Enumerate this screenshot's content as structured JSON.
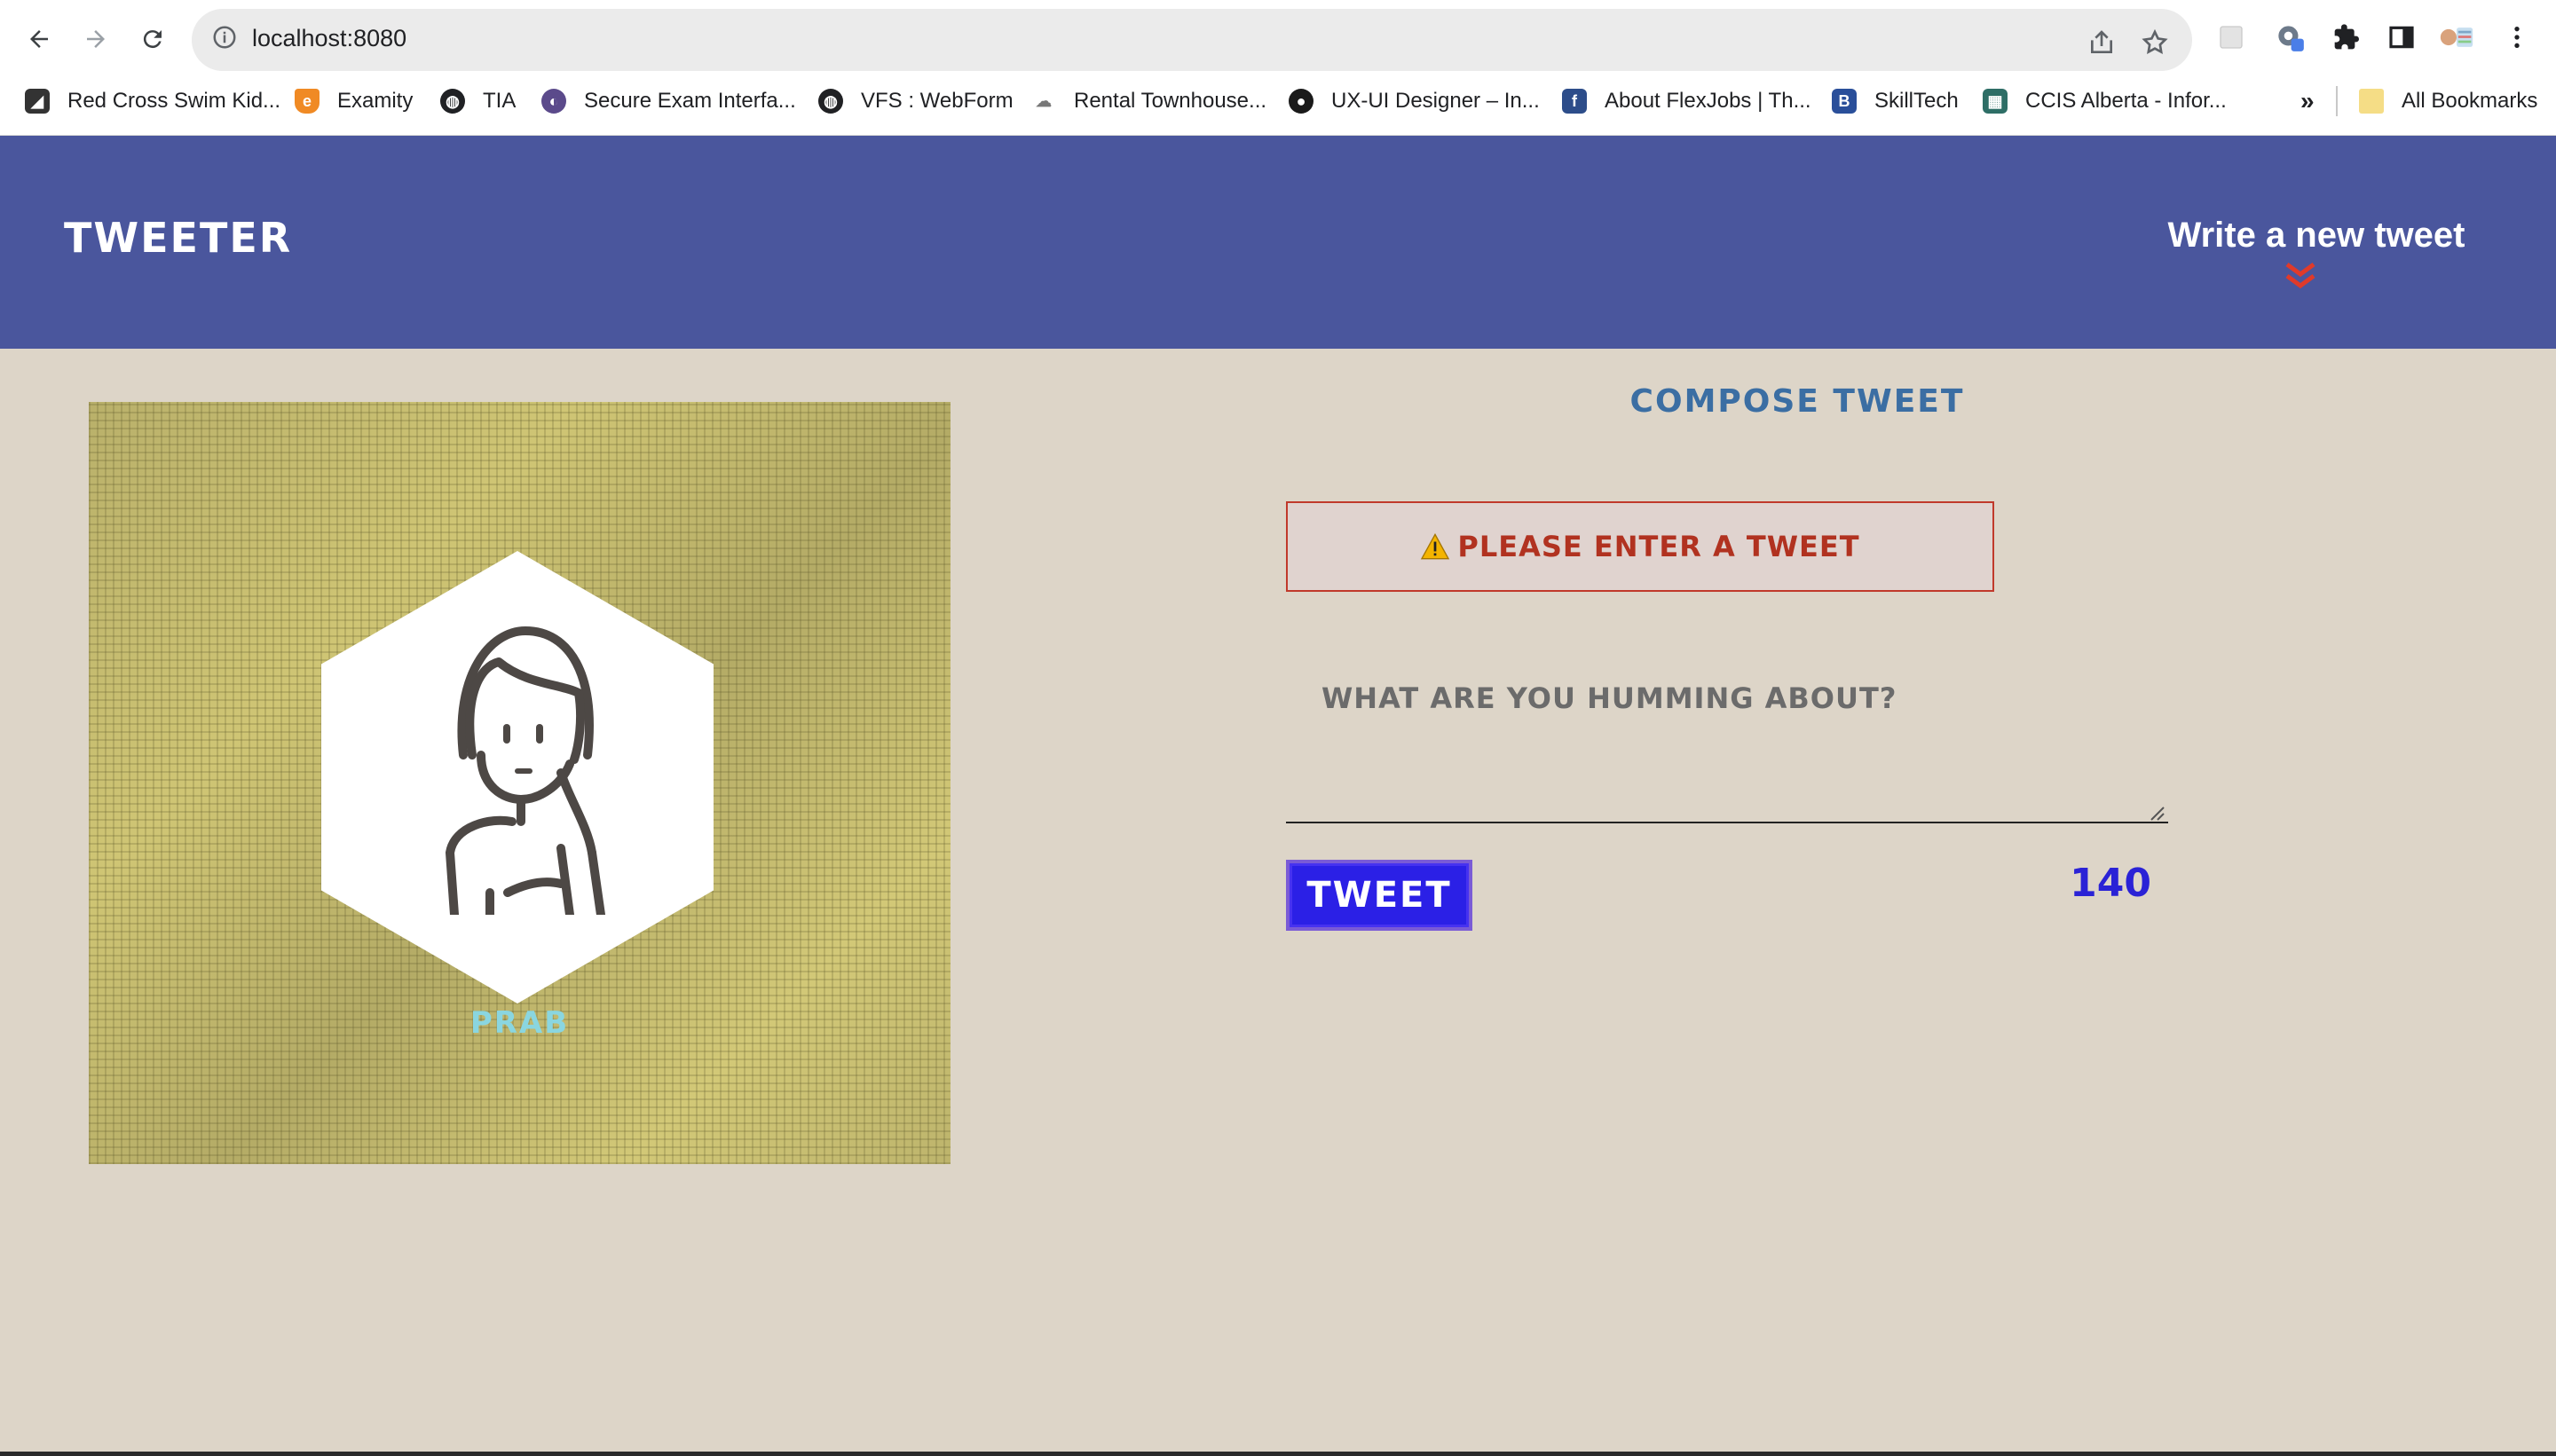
{
  "browser": {
    "url": "localhost:8080",
    "bookmarks": [
      {
        "label": "Red Cross Swim Kid...",
        "icon": "red-cross-icon"
      },
      {
        "label": "Examity",
        "icon": "examity-icon"
      },
      {
        "label": "TIA",
        "icon": "globe-icon"
      },
      {
        "label": "Secure Exam Interfa...",
        "icon": "secure-exam-icon"
      },
      {
        "label": "VFS : WebForm",
        "icon": "globe-icon"
      },
      {
        "label": "Rental Townhouse...",
        "icon": "cloud-icon"
      },
      {
        "label": "UX-UI Designer – In...",
        "icon": "circle-icon"
      },
      {
        "label": "About FlexJobs | Th...",
        "icon": "flexjobs-icon"
      },
      {
        "label": "SkillTech",
        "icon": "skilltech-icon"
      },
      {
        "label": "CCIS Alberta - Infor...",
        "icon": "ccis-icon"
      }
    ],
    "overflow_label": "»",
    "all_bookmarks_label": "All Bookmarks"
  },
  "header": {
    "brand": "Tweeter",
    "new_tweet_label": "Write a new tweet"
  },
  "profile": {
    "username": "Prab"
  },
  "compose": {
    "title": "Compose Tweet",
    "error": "Please enter a tweet",
    "placeholder": "What are you humming about?",
    "button_label": "Tweet",
    "counter": "140"
  },
  "colors": {
    "header_bg": "#4a569d",
    "page_bg": "#ddd5c8",
    "error_red": "#b13220",
    "button_blue": "#2b20e6",
    "counter_blue": "#2a22d6",
    "title_blue": "#3b6ea3"
  }
}
